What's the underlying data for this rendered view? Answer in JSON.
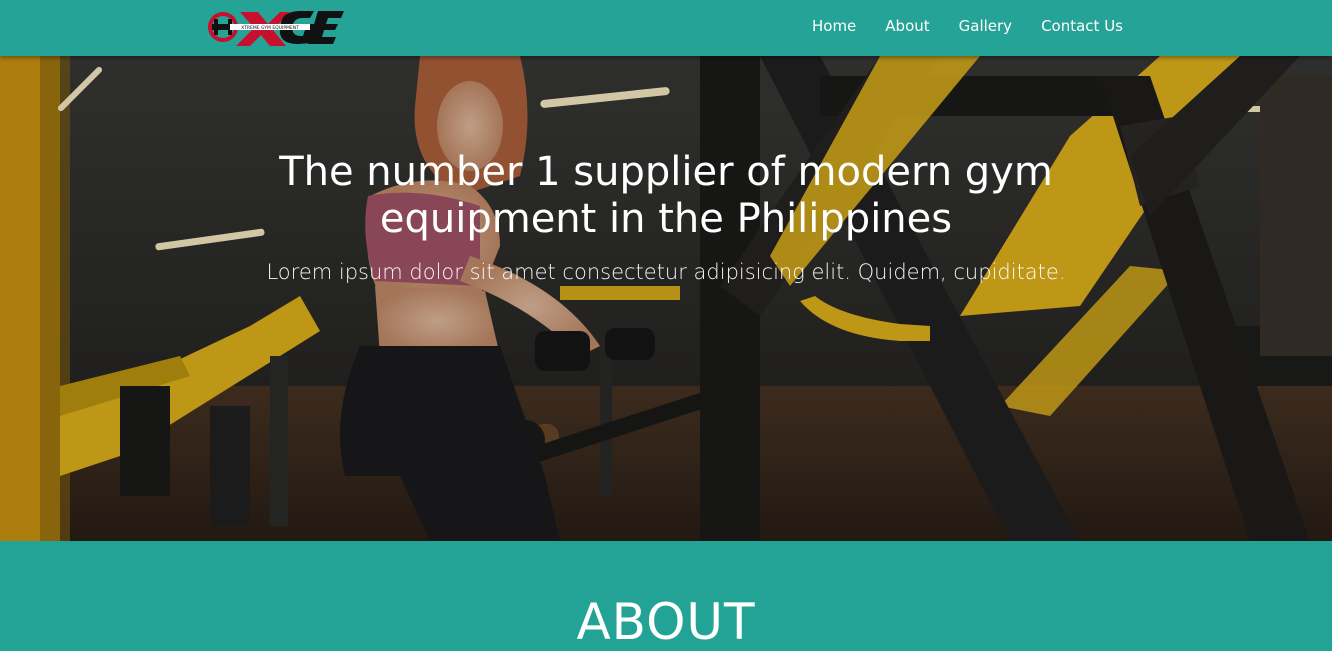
{
  "brand": {
    "logo_text": "XGE",
    "logo_tagline": "XTREME GYM EQUIPMENT"
  },
  "nav": {
    "items": [
      {
        "label": "Home"
      },
      {
        "label": "About"
      },
      {
        "label": "Gallery"
      },
      {
        "label": "Contact Us"
      }
    ]
  },
  "hero": {
    "title_line1": "The number 1 supplier of modern gym",
    "title_line2": "equipment in the Philippines",
    "subtitle": "Lorem ipsum dolor sit amet consectetur adipisicing elit. Quidem, cupiditate."
  },
  "about": {
    "heading": "ABOUT"
  },
  "colors": {
    "primary": "#24a396",
    "accent_yellow": "#e8b91c",
    "logo_red": "#c8102e"
  }
}
